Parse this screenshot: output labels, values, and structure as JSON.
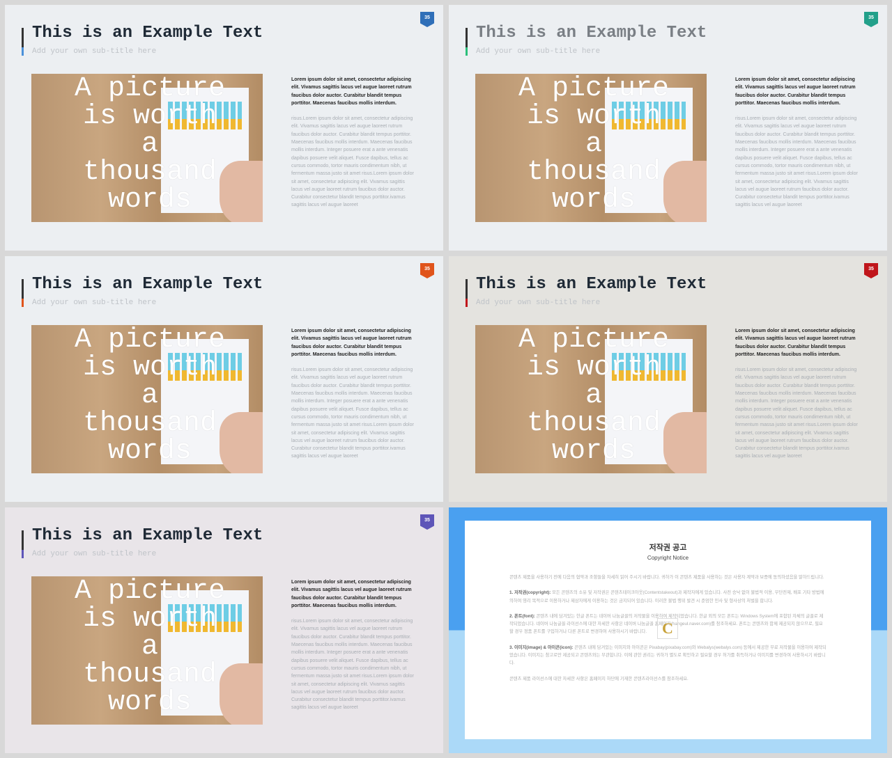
{
  "slides": [
    {
      "title": "This is an Example Text",
      "subtitle": "Add your own sub-title here",
      "page": "35",
      "accent": "#2f6fb8",
      "bar_accent": "#4a90d9",
      "title_color": "#1f2a36",
      "bg": "#eceff2"
    },
    {
      "title": "This is an Example Text",
      "subtitle": "Add your own sub-title here",
      "page": "35",
      "accent": "#22a08a",
      "bar_accent": "#2bbf7a",
      "title_color": "#7a7f85",
      "bg": "#eceff2"
    },
    {
      "title": "This is an Example Text",
      "subtitle": "Add your own sub-title here",
      "page": "35",
      "accent": "#e0541b",
      "bar_accent": "#e0541b",
      "title_color": "#1f2a36",
      "bg": "#eceff2"
    },
    {
      "title": "This is an Example Text",
      "subtitle": "Add your own sub-title here",
      "page": "35",
      "accent": "#c0161b",
      "bar_accent": "#c0161b",
      "title_color": "#1f2a36",
      "bg": "#e4e3df"
    },
    {
      "title": "This is an Example Text",
      "subtitle": "Add your own sub-title here",
      "page": "35",
      "accent": "#5e55b8",
      "bar_accent": "#5e55b8",
      "title_color": "#1f2a36",
      "bg": "#e9e5e9"
    }
  ],
  "image_alt": "A picture\nis worth\na\nthousand\nwords",
  "body_bold": "Lorem ipsum dolor sit amet, consectetur adipiscing elit. Vivamus sagittis lacus vel augue laoreet rutrum faucibus dolor auctor. Curabitur blandit tempus porttitor. Maecenas faucibus mollis interdum.",
  "body_light": "risus.Lorem ipsum dolor sit amet, consectetur adipiscing elit. Vivamus sagittis lacus vel augue laoreet rutrum faucibus dolor auctor. Curabitur blandit tempus porttitor. Maecenas faucibus mollis interdum. Maecenas faucibus mollis interdum. Integer posuere erat a ante venenatis dapibus posuere velit aliquet. Fusce dapibus, tellus ac cursus commodo, tortor mauris condimentum nibh, ut fermentum massa justo sit amet risus.Lorem ipsum dolor sit amet, consectetur adipiscing elit. Vivamus sagittis lacus vel augue laoreet rutrum faucibus dolor auctor. Curabitur consectetur blandit tempus porttitor.ivamus sagittis lacus vel augue laoreet",
  "copyright": {
    "title": "저작권 공고",
    "subtitle": "Copyright Notice",
    "intro": "콘텐츠 제품을 사용하기 전에 다음의 협약과 조항들을 자세히 읽어 주시기 바랍니다. 귀하가 이 콘텐츠 제품을 사용하는 것은 사용자 계약과 보증에 동의하셨음을 말하드립니다.",
    "s1_head": "1. 저작권(copyright):",
    "s1": " 모든 콘텐츠의 소유 및 저작권은 콘텐츠테이크아웃(Contentstakeout)과 제작자에게 있습니다. 사전 승낙 없이 불법적 이용, 무단전재, 배포 기타 방법에 의하여 영리 목적으로 이용하거나 제삼자에게 이용하는 것은 금지되어 있습니다. 이러한 불법 행위 발견 시 준엄한 민사 및 형사상의 처벌을 합니다.",
    "s2_head": "2. 폰트(font):",
    "s2": " 콘텐츠 내에 담겨있는 한글 폰트는 네이버 나눔글꼴의 저작물을 이용하여 제작되었습니다. 한글 외의 모든 폰트는 Windows System에 포함된 자체의 글꼴로 제작되었습니다. 네이버 나눔글꼴 라이선스에 대한 자세한 사항은 네이버 나눔글꼴 홈페이지(hangeul.naver.com)를 참조하세요. 폰트는 콘텐츠와 함께 제공되지 않으므로, 필요할 경우 정품 폰트를 구입하거나 다른 폰트로 변경하여 사용하시기 바랍니다.",
    "s3_head": "3. 이미지(image) & 아이콘(icon):",
    "s3": " 콘텐츠 내에 담겨있는 이미지와 아이콘은 Pixabay(pixabay.com)와 Webalys(webalys.com) 등에서 제공한 무료 저작물을 이용하여 제작되었습니다. 이미지는 참고로만 제공되고 콘텐츠와는 무관합니다. 이에 관한 권리는 귀하가 별도로 확인하고 필요할 경우 허가를 취득하거나 이미지를 변경하여 사용하시기 바랍니다.",
    "outro": "콘텐츠 제품 라이선스에 대한 자세한 사항은 홈페이지 하단에 기재한 콘텐츠라이선스를 참조하세요.",
    "logo": "C",
    "top_color": "#4aa0f0",
    "bottom_color": "#abd9f8"
  }
}
